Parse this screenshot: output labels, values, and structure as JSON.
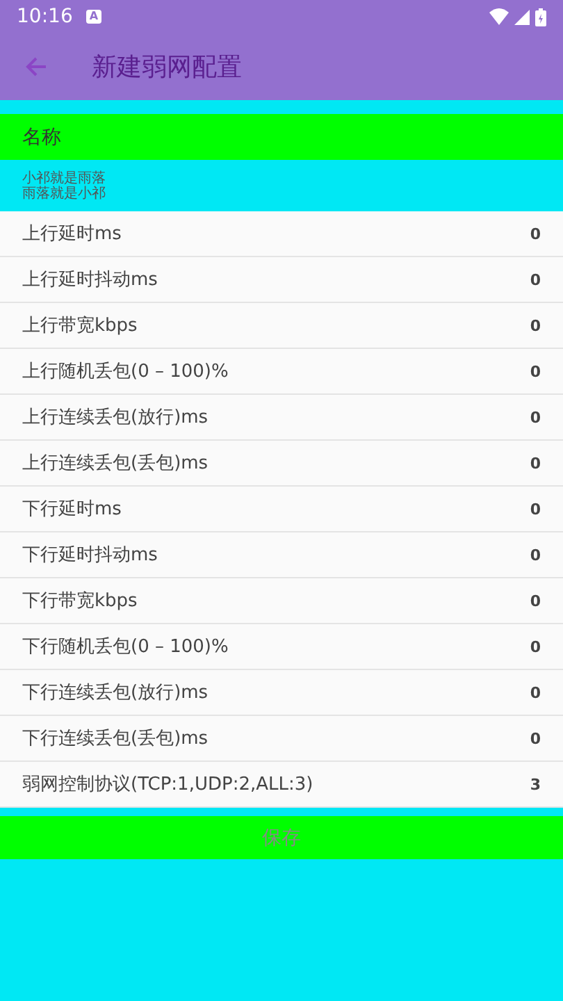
{
  "status_bar": {
    "time": "10:16",
    "notification": "A"
  },
  "app_bar": {
    "title": "新建弱网配置"
  },
  "name_field": {
    "label": "名称"
  },
  "note": [
    "小祁就是雨落",
    "雨落就是小祁"
  ],
  "fields": [
    {
      "label": "上行延时ms",
      "value": "0"
    },
    {
      "label": "上行延时抖动ms",
      "value": "0"
    },
    {
      "label": "上行带宽kbps",
      "value": "0"
    },
    {
      "label": "上行随机丢包(0 – 100)%",
      "value": "0"
    },
    {
      "label": "上行连续丢包(放行)ms",
      "value": "0"
    },
    {
      "label": "上行连续丢包(丢包)ms",
      "value": "0"
    },
    {
      "label": "下行延时ms",
      "value": "0"
    },
    {
      "label": "下行延时抖动ms",
      "value": "0"
    },
    {
      "label": "下行带宽kbps",
      "value": "0"
    },
    {
      "label": "下行随机丢包(0 – 100)%",
      "value": "0"
    },
    {
      "label": "下行连续丢包(放行)ms",
      "value": "0"
    },
    {
      "label": "下行连续丢包(丢包)ms",
      "value": "0"
    },
    {
      "label": "弱网控制协议(TCP:1,UDP:2,ALL:3)",
      "value": "3"
    }
  ],
  "save_button": {
    "label": "保存"
  }
}
